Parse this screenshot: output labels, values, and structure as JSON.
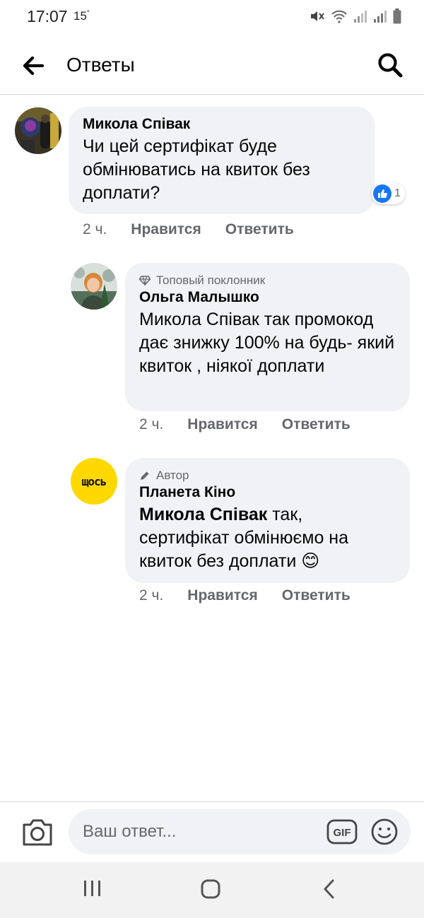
{
  "status_bar": {
    "time": "17:07",
    "temperature": "15",
    "degree": "°"
  },
  "header": {
    "title": "Ответы"
  },
  "comments": [
    {
      "author": "Микола Співак",
      "text": "Чи цей сертифікат буде обмінюватись на квиток без доплати?",
      "time": "2 ч.",
      "like_label": "Нравится",
      "reply_label": "Ответить",
      "reaction_count": "1",
      "reaction_icon": "thumbs-up-icon"
    },
    {
      "badge": "Топовый поклонник",
      "badge_icon": "diamond-icon",
      "author": "Ольга Малышко",
      "text": "Микола Співак так промокод дає знижку 100% на будь- який квиток , ніякої доплати",
      "time": "2 ч.",
      "like_label": "Нравится",
      "reply_label": "Ответить"
    },
    {
      "badge": "Автор",
      "badge_icon": "pencil-icon",
      "author": "Планета Кіно",
      "mention": "Микола Співак",
      "text": " так, сертифікат обмінюємо на квиток без доплати ",
      "emoji": "😊",
      "time": "2 ч.",
      "like_label": "Нравится",
      "reply_label": "Ответить",
      "avatar_logo_text": "щось"
    }
  ],
  "composer": {
    "placeholder": "Ваш ответ...",
    "gif_label": "GIF"
  },
  "colors": {
    "bubble": "#f0f2f5",
    "secondary_text": "#65676b",
    "like_blue": "#1877f2",
    "brand_yellow": "#ffd800"
  }
}
